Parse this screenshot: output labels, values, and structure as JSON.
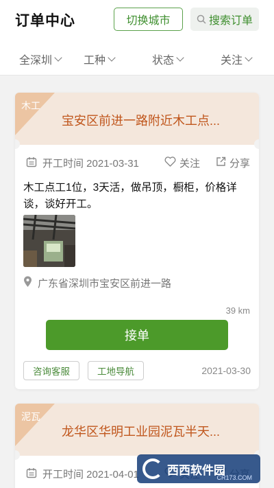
{
  "header": {
    "title": "订单中心",
    "switch_city_label": "切换城市",
    "search_label": "搜索订单"
  },
  "filters": [
    {
      "label": "全深圳"
    },
    {
      "label": "工种"
    },
    {
      "label": "状态"
    },
    {
      "label": "关注"
    }
  ],
  "orders": [
    {
      "trade": "木工",
      "title": "宝安区前进一路附近木工点...",
      "start_time": "开工时间 2021-03-31",
      "follow_label": "关注",
      "share_label": "分享",
      "description": "木工点工1位，3天活，做吊顶，橱柜，价格详谈，谈好开工。",
      "address": "广东省深圳市宝安区前进一路",
      "distance": "39 km",
      "accept_label": "接单",
      "consult_label": "咨询客服",
      "navigate_label": "工地导航",
      "posted_date": "2021-03-30"
    },
    {
      "trade": "泥瓦",
      "title": "龙华区华明工业园泥瓦半天...",
      "start_time": "开工时间 2021-04-01",
      "follow_label": "关注",
      "share_label": "分享"
    }
  ],
  "watermark": {
    "brand": "西西软件园",
    "url": "CR173.COM"
  },
  "colors": {
    "accent_green": "#4c9a2a",
    "title_orange": "#c0561c",
    "card_header_bg": "#f4e7dc",
    "ribbon": "#ecc5a3"
  }
}
